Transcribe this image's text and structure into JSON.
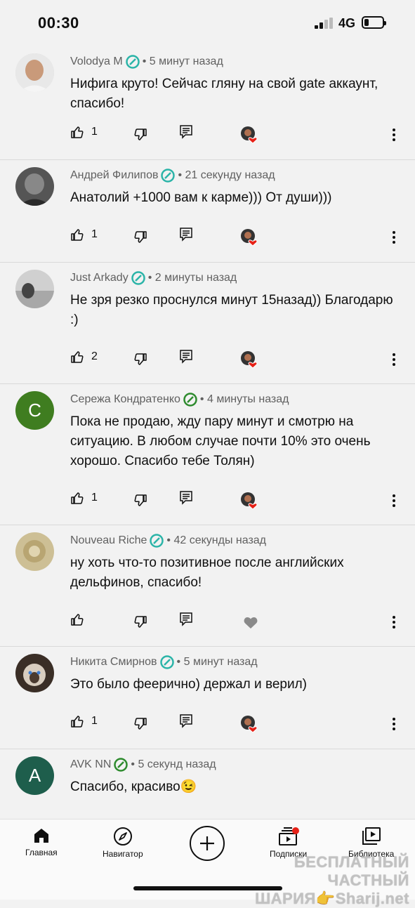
{
  "status": {
    "time": "00:30",
    "network": "4G"
  },
  "comments": [
    {
      "author": "Volodya M",
      "time": "5 минут назад",
      "text": "Нифига круто! Сейчас гляну на свой gate аккаунт, спасибо!",
      "likes": "1",
      "badge_color": "#2bb4a8",
      "avatar_letter": "",
      "avatar_color": "#c9c9c9"
    },
    {
      "author": "Андрей Филипов",
      "time": "21 секунду назад",
      "text": "Анатолий +1000 вам к карме))) От души)))",
      "likes": "1",
      "badge_color": "#2bb4a8",
      "avatar_letter": "",
      "avatar_color": "#777777"
    },
    {
      "author": "Just Arkady",
      "time": "2 минуты назад",
      "text": "Не зря резко проснулся минут 15назад)) Благодарю :)",
      "likes": "2",
      "badge_color": "#2bb4a8",
      "avatar_letter": "",
      "avatar_color": "#9a9a9a"
    },
    {
      "author": "Сережа Кондратенко",
      "time": "4 минуты назад",
      "text": "Пока не продаю, жду пару минут и смотрю на ситуацию. В любом случае почти 10% это очень хорошо. Спасибо тебе Толян)",
      "likes": "1",
      "badge_color": "#2e8b2e",
      "avatar_letter": "C",
      "avatar_color": "#3f7d20"
    },
    {
      "author": "Nouveau Riche",
      "time": "42 секунды назад",
      "text": "ну хоть что-то позитивное после английских дельфинов, спасибо!",
      "likes": "",
      "badge_color": "#2bb4a8",
      "avatar_letter": "",
      "avatar_color": "#c7b98f"
    },
    {
      "author": "Никита Смирнов",
      "time": "5 минут назад",
      "text": "Это было феерично) держал и верил)",
      "likes": "1",
      "badge_color": "#2bb4a8",
      "avatar_letter": "",
      "avatar_color": "#6b5a4a"
    },
    {
      "author": "AVK NN",
      "time": "5 секунд назад",
      "text": "Спасибо, красиво😉",
      "likes": "",
      "badge_color": "#2e8b2e",
      "avatar_letter": "A",
      "avatar_color": "#1e5e4c"
    }
  ],
  "nav": {
    "home": "Главная",
    "explore": "Навигатор",
    "subscriptions": "Подписки",
    "library": "Библиотека"
  },
  "watermark": {
    "line1": "БЕСПЛАТНЫЙ ЧАСТНЫЙ",
    "line2": "ШАРИЯ👉Sharij.net"
  }
}
